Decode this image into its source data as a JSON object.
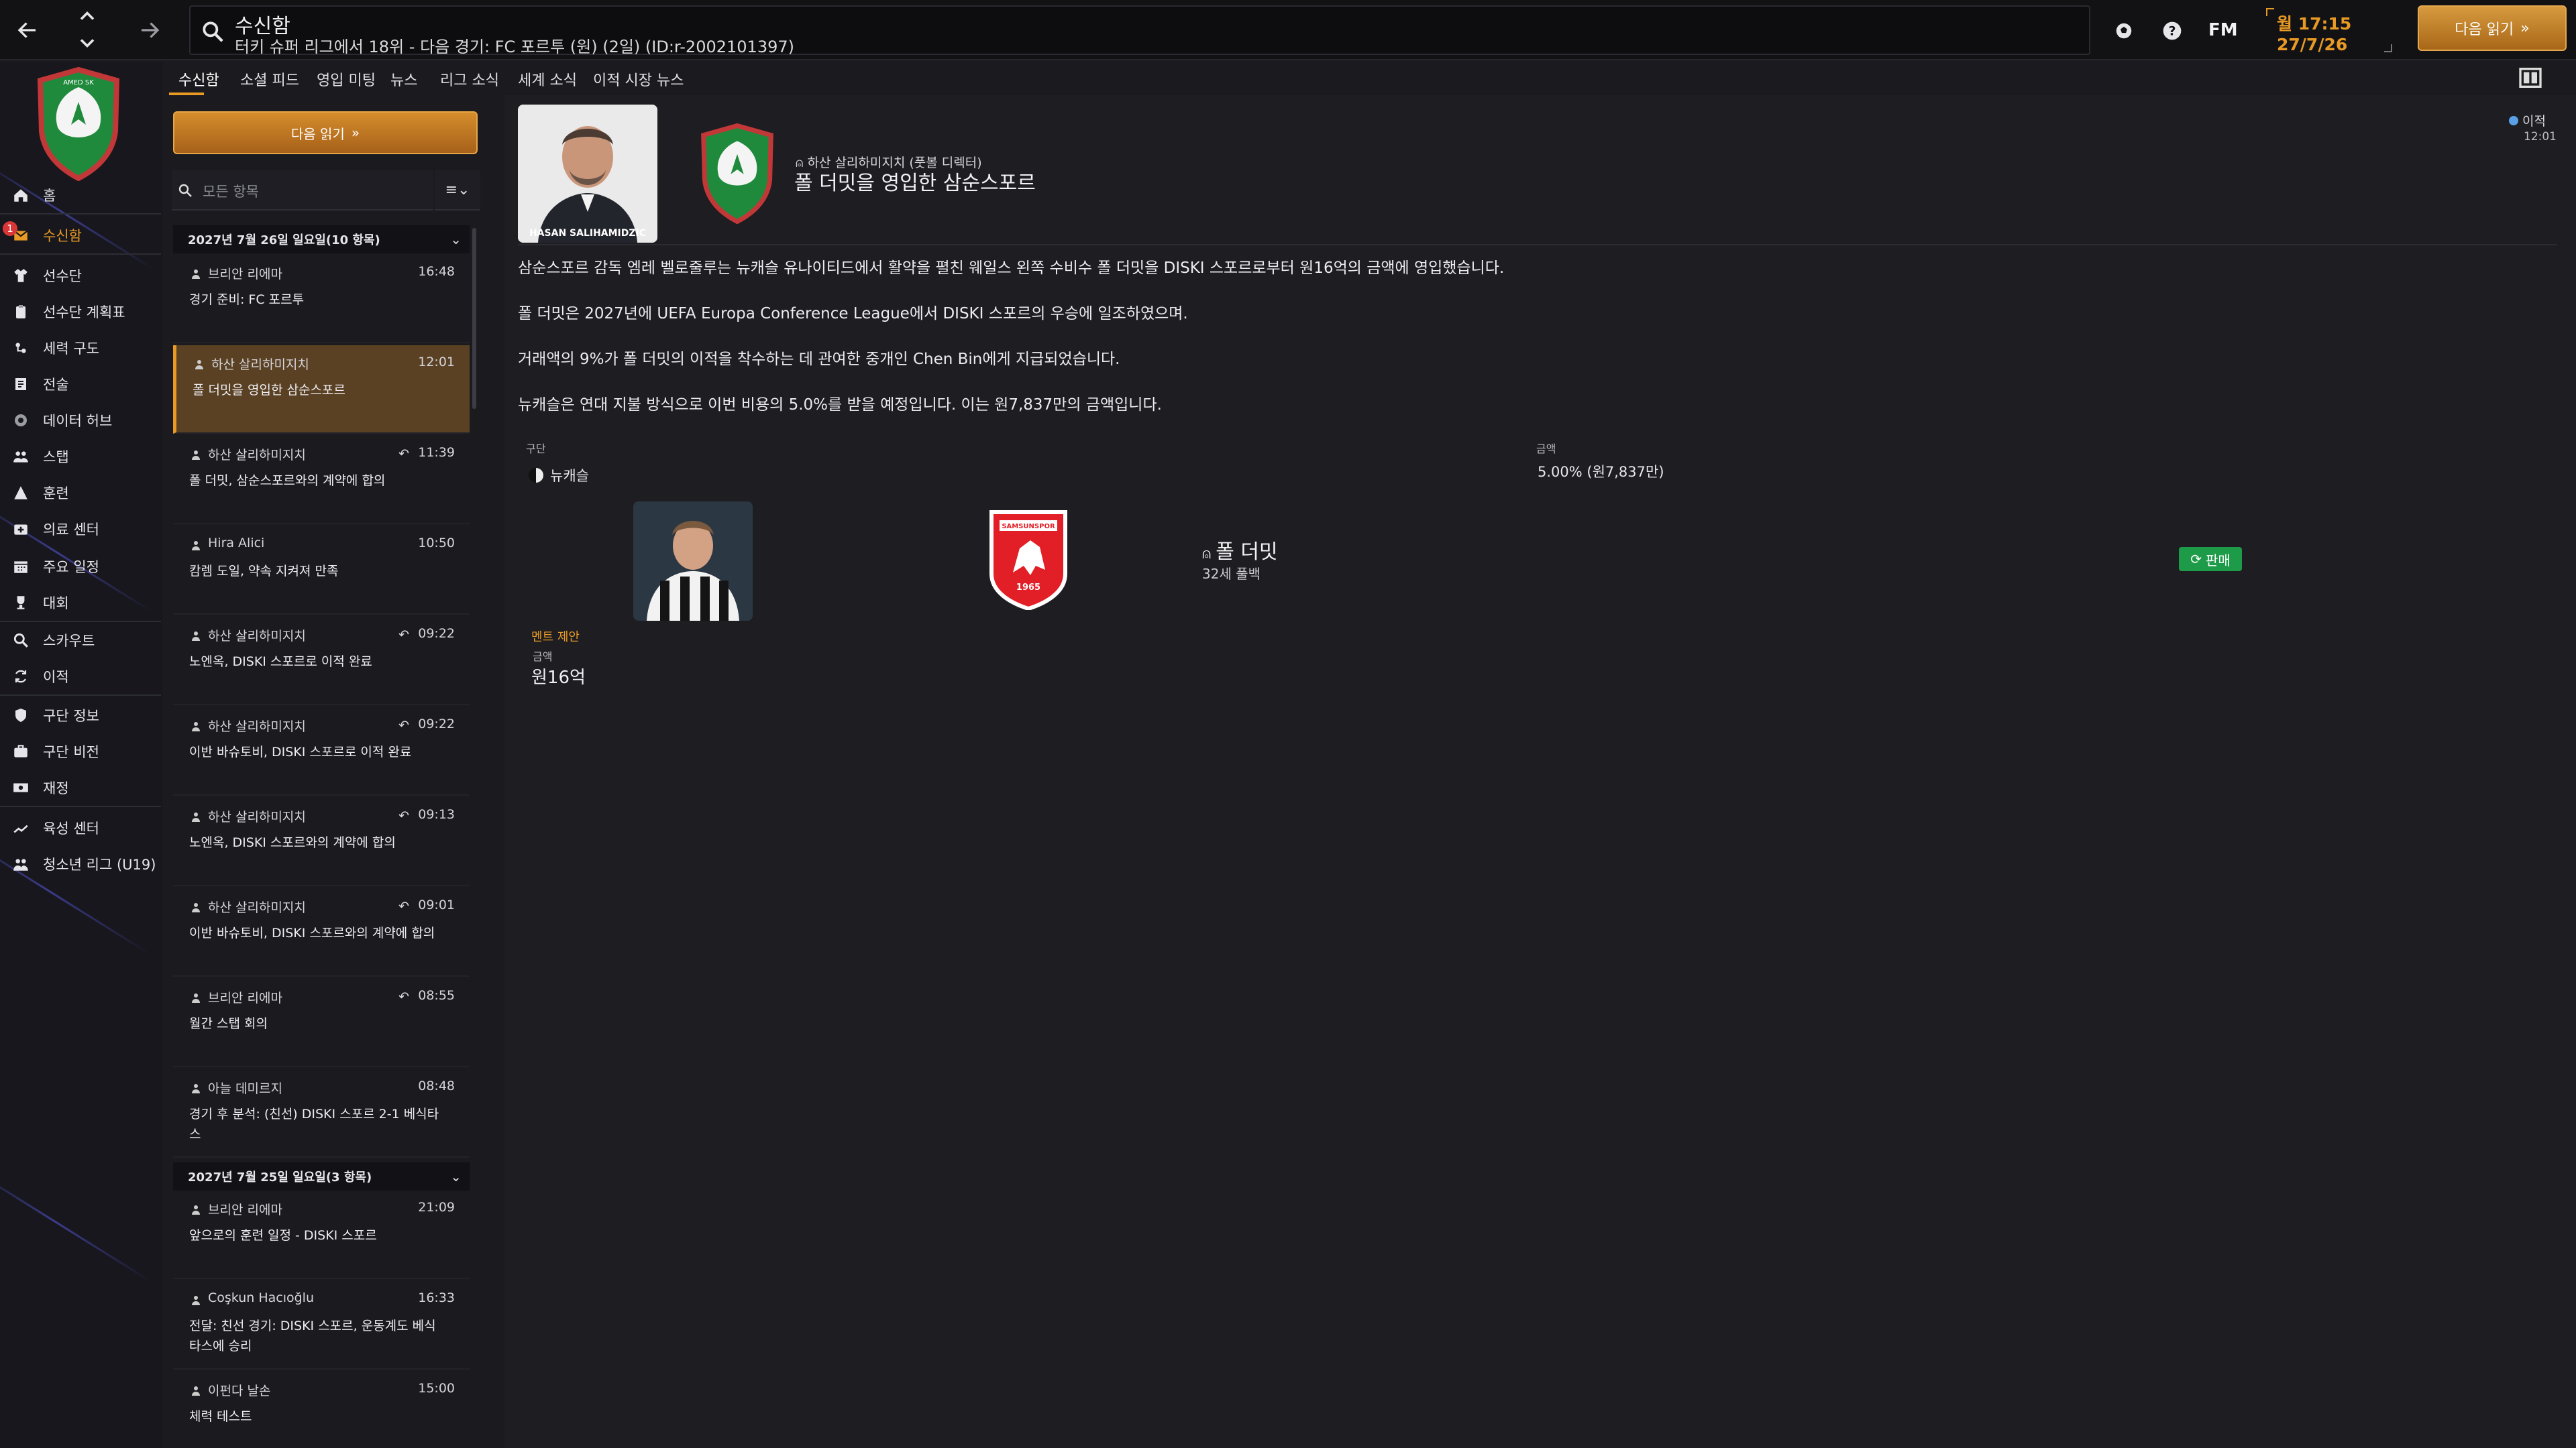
{
  "topbar": {
    "title": "수신함",
    "subtitle": "터키 슈퍼 리그에서 18위 - 다음 경기: FC 포르투 (원) (2일) (ID:r-2002101397)",
    "fm_logo": "FM",
    "clock_line1": "월 17:15",
    "clock_line2": "27/7/26",
    "continue_label": "다음 읽기",
    "icons": [
      "back-arrow-icon",
      "scroll-up-icon",
      "scroll-down-icon",
      "forward-arrow-icon",
      "search-icon",
      "ball-icon",
      "help-icon"
    ]
  },
  "sidebar": {
    "accent": "#e89a24",
    "badge_count": "1",
    "items": [
      {
        "label": "홈",
        "icon": "home-icon"
      },
      {
        "label": "수신함",
        "icon": "inbox-icon",
        "active": true
      },
      {
        "label": "선수단",
        "icon": "shirt-icon"
      },
      {
        "label": "선수단 계획표",
        "icon": "clipboard-icon"
      },
      {
        "label": "세력 구도",
        "icon": "dynamics-icon"
      },
      {
        "label": "전술",
        "icon": "tactics-icon"
      },
      {
        "label": "데이터 허브",
        "icon": "data-hub-icon"
      },
      {
        "label": "스탭",
        "icon": "staff-icon"
      },
      {
        "label": "훈련",
        "icon": "training-icon"
      },
      {
        "label": "의료 센터",
        "icon": "medical-icon"
      },
      {
        "label": "주요 일정",
        "icon": "calendar-icon"
      },
      {
        "label": "대회",
        "icon": "trophy-icon"
      },
      {
        "label": "스카우트",
        "icon": "scout-icon"
      },
      {
        "label": "이적",
        "icon": "transfer-icon"
      },
      {
        "label": "구단 정보",
        "icon": "club-info-icon"
      },
      {
        "label": "구단 비전",
        "icon": "club-vision-icon"
      },
      {
        "label": "재정",
        "icon": "finance-icon"
      },
      {
        "label": "육성 센터",
        "icon": "development-icon"
      },
      {
        "label": "청소년 리그 (U19)",
        "icon": "youth-icon"
      }
    ]
  },
  "tabs": [
    "수신함",
    "소셜 피드",
    "영입 미팅",
    "뉴스",
    "리그 소식",
    "세계 소식",
    "이적 시장 뉴스"
  ],
  "list": {
    "continue_label": "다음 읽기",
    "search_placeholder": "모든 항목",
    "filter_icon": "≡⌄",
    "groups": [
      {
        "title": "2027년 7월 26일 일요일(10 항목)"
      },
      {
        "title": "2027년 7월 25일 일요일(3 항목)"
      }
    ],
    "messages": [
      {
        "sender": "브리안 리에마",
        "time": "16:48",
        "subject": "경기 준비: FC 포르투",
        "reply": false
      },
      {
        "sender": "하산 살리하미지치",
        "time": "12:01",
        "subject": "폴 더밋을 영입한 삼순스포르",
        "reply": false,
        "selected": true
      },
      {
        "sender": "하산 살리하미지치",
        "time": "11:39",
        "subject": "폴 더밋, 삼순스포르와의 계약에 합의",
        "reply": true
      },
      {
        "sender": "Hira Alici",
        "time": "10:50",
        "subject": "캄렘 도일, 약속 지켜져 만족",
        "reply": false
      },
      {
        "sender": "하산 살리하미지치",
        "time": "09:22",
        "subject": "노엔옥, DISKI 스포르로 이적 완료",
        "reply": true
      },
      {
        "sender": "하산 살리하미지치",
        "time": "09:22",
        "subject": "이반 바슈토비, DISKI 스포르로 이적 완료",
        "reply": true
      },
      {
        "sender": "하산 살리하미지치",
        "time": "09:13",
        "subject": "노엔옥, DISKI 스포르와의 계약에 합의",
        "reply": true
      },
      {
        "sender": "하산 살리하미지치",
        "time": "09:01",
        "subject": "이반 바슈토비, DISKI 스포르와의 계약에 합의",
        "reply": true
      },
      {
        "sender": "브리안 리에마",
        "time": "08:55",
        "subject": "월간 스탭 회의",
        "reply": true
      },
      {
        "sender": "아늘 데미르지",
        "time": "08:48",
        "subject": "경기 후 분석: (친선) DISKI 스포르 2-1 베식타스",
        "reply": false
      },
      {
        "sender": "브리안 리에마",
        "time": "21:09",
        "subject": "앞으로의 훈련 일정 - DISKI 스포르",
        "reply": false
      },
      {
        "sender": "Coşkun Hacıoğlu",
        "time": "16:33",
        "subject": "전달: 친선 경기: DISKI 스포르, 운동계도 베식타스에 승리",
        "reply": false
      },
      {
        "sender": "이펀다 날손",
        "time": "15:00",
        "subject": "체력 테스트",
        "reply": false
      }
    ]
  },
  "article": {
    "sender_line": "하산 살리하미지치 (풋볼 디렉터)",
    "headline": "폴 더밋을 영입한 삼순스포르",
    "tag": "이적",
    "tag_time": "12:01",
    "photo_caption": "HASAN SALIHAMIDZIC",
    "paragraphs": [
      "삼순스포르 감독 엠레 벨로줄루는 뉴캐슬 유나이티드에서 활약을 펼친 웨일스 왼쪽 수비수 폴 더밋을 DISKI 스포르로부터 원16억의 금액에 영입했습니다.",
      "폴 더밋은 2027년에 UEFA Europa Conference League에서 DISKI 스포르의 우승에 일조하였으며.",
      "거래액의 9%가 폴 더밋의 이적을 착수하는 데 관여한 중개인 Chen Bin에게 지급되었습니다.",
      "뉴캐슬은 연대 지불 방식으로 이번 비용의 5.0%를 받을 예정입니다. 이는 원7,837만의 금액입니다."
    ],
    "table": {
      "club_header": "구단",
      "fee_header": "금액",
      "club_name": "뉴캐슬",
      "fee_share": "5.00% (원7,837만)"
    },
    "player": {
      "name": "폴 더밋",
      "meta": "32세 풀백",
      "sell_label": "판매",
      "clause_label": "멘트 제안",
      "fee_label": "금액",
      "fee_value": "원16억"
    },
    "new_club_badge_text": "SAMSUNSPOR",
    "new_club_badge_year": "1965"
  }
}
